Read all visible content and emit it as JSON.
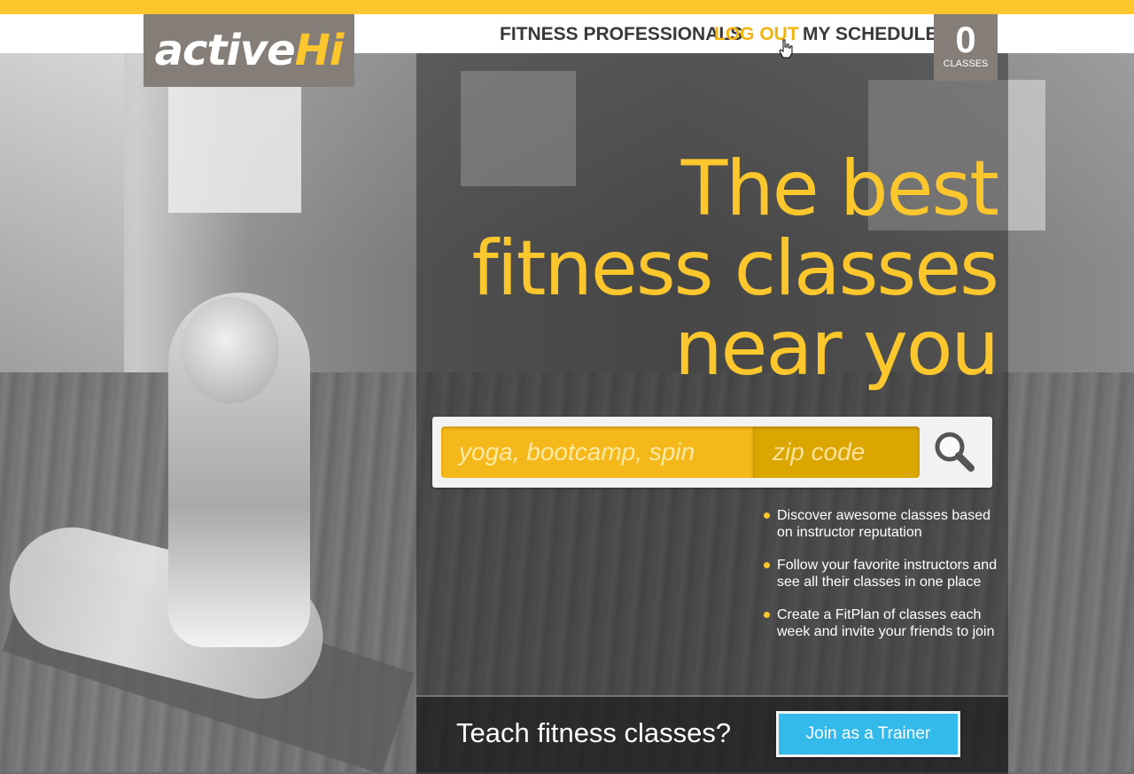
{
  "brand": {
    "part1": "active",
    "part2": "Hi"
  },
  "nav": {
    "fitness_professionals": "FITNESS PROFESSIONALS",
    "log_out": "LOG OUT",
    "my_schedule": "MY SCHEDULE"
  },
  "classes_counter": {
    "count": "0",
    "label": "CLASSES"
  },
  "hero": {
    "line1": "The best",
    "line2": "fitness classes",
    "line3": "near you"
  },
  "search": {
    "activity_placeholder": "yoga, bootcamp, spin",
    "zip_placeholder": "zip code",
    "icon": "search-icon"
  },
  "features": [
    "Discover awesome classes based on instructor reputation",
    "Follow your favorite instructors and see all their classes in one place",
    "Create a FitPlan of classes each week and invite your friends to join"
  ],
  "trainer": {
    "prompt": "Teach fitness classes?",
    "button": "Join as a Trainer"
  },
  "colors": {
    "accent_yellow": "#fcc72d",
    "logo_box": "#857d78",
    "button_blue": "#33b9ea"
  }
}
